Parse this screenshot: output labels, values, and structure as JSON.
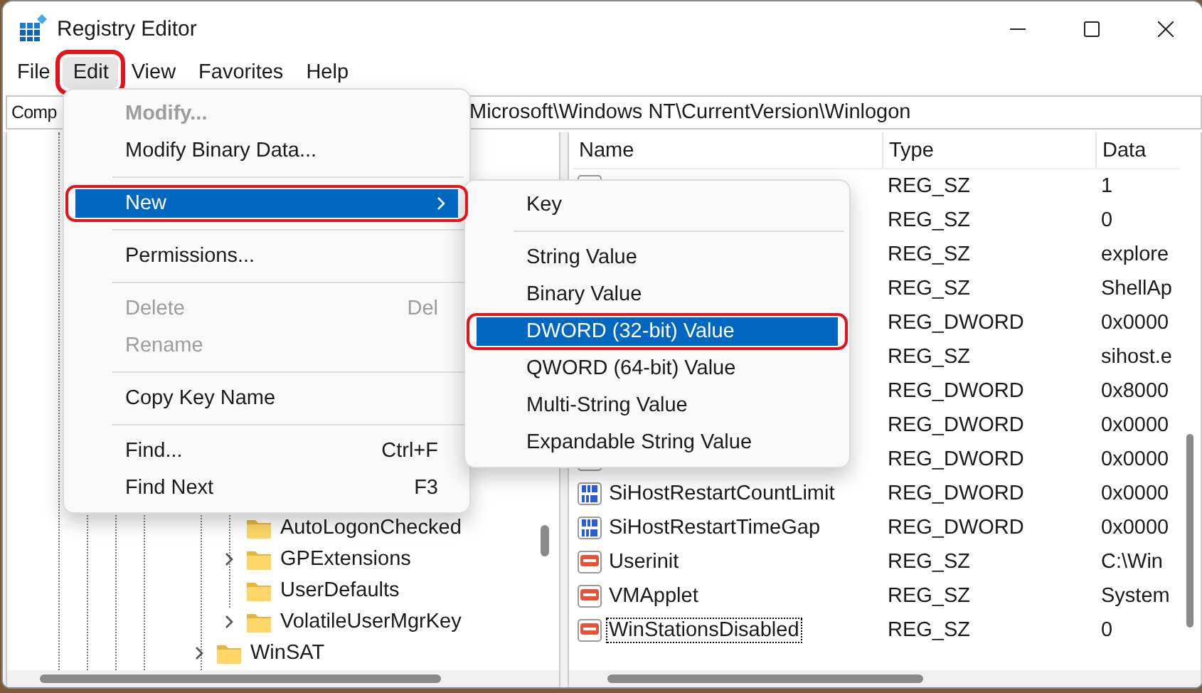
{
  "window": {
    "title": "Registry Editor"
  },
  "menu_bar": [
    {
      "label": "File",
      "open": false,
      "highlighted": false
    },
    {
      "label": "Edit",
      "open": true,
      "highlighted": true
    },
    {
      "label": "View",
      "open": false,
      "highlighted": false
    },
    {
      "label": "Favorites",
      "open": false,
      "highlighted": false
    },
    {
      "label": "Help",
      "open": false,
      "highlighted": false
    }
  ],
  "address_bar": {
    "text_start": "Comp",
    "text_end": "Microsoft\\Windows NT\\CurrentVersion\\Winlogon"
  },
  "tree": {
    "items": [
      {
        "children": [
          {
            "label": "AutoLogonChecked",
            "expandable": false
          },
          {
            "label": "GPExtensions",
            "expandable": true
          },
          {
            "label": "UserDefaults",
            "expandable": false
          },
          {
            "label": "VolatileUserMgrKey",
            "expandable": true
          }
        ]
      },
      {
        "label": "WinSAT",
        "expandable": true
      }
    ]
  },
  "values": {
    "columns": [
      "Name",
      "Type",
      "Data"
    ],
    "rows": [
      {
        "kind": "string",
        "type": "REG_SZ",
        "data": "1",
        "focused": false
      },
      {
        "type": "REG_SZ",
        "data": "0",
        "focused": false
      },
      {
        "type": "REG_SZ",
        "data": "explore",
        "focused": false
      },
      {
        "type": "REG_SZ",
        "data": "ShellAp",
        "focused": false
      },
      {
        "type": "REG_DWORD",
        "data": "0x0000",
        "focused": false
      },
      {
        "type": "REG_SZ",
        "data": "sihost.e",
        "focused": false
      },
      {
        "type": "REG_DWORD",
        "data": "0x8000",
        "focused": false
      },
      {
        "type": "REG_DWORD",
        "data": "0x0000",
        "focused": false
      },
      {
        "kind": "dword",
        "type": "REG_DWORD",
        "data": "0x0000",
        "focused": false
      },
      {
        "kind": "dword",
        "name": "SiHostRestartCountLimit",
        "type": "REG_DWORD",
        "data": "0x0000",
        "focused": false
      },
      {
        "kind": "dword",
        "name": "SiHostRestartTimeGap",
        "type": "REG_DWORD",
        "data": "0x0000",
        "focused": false
      },
      {
        "kind": "string",
        "name": "Userinit",
        "type": "REG_SZ",
        "data": "C:\\Win",
        "focused": false
      },
      {
        "kind": "string",
        "name": "VMApplet",
        "type": "REG_SZ",
        "data": "System",
        "focused": false
      },
      {
        "kind": "string",
        "name": "WinStationsDisabled",
        "type": "REG_SZ",
        "data": "0",
        "focused": true
      }
    ]
  },
  "edit_menu": {
    "items": [
      {
        "kind": "item",
        "label": "Modify...",
        "default": true,
        "disabled": true,
        "selected": false,
        "highlighted": false,
        "submenu": false
      },
      {
        "kind": "item",
        "label": "Modify Binary Data...",
        "default": false,
        "disabled": false,
        "selected": false,
        "highlighted": false,
        "submenu": false
      },
      {
        "kind": "separator"
      },
      {
        "kind": "item",
        "label": "New",
        "default": false,
        "disabled": false,
        "selected": true,
        "highlighted": true,
        "submenu": true
      },
      {
        "kind": "separator"
      },
      {
        "kind": "item",
        "label": "Permissions...",
        "default": false,
        "disabled": false,
        "selected": false,
        "highlighted": false,
        "submenu": false
      },
      {
        "kind": "separator"
      },
      {
        "kind": "item",
        "label": "Delete",
        "shortcut": "Del",
        "default": false,
        "disabled": true,
        "selected": false,
        "highlighted": false,
        "submenu": false
      },
      {
        "kind": "item",
        "label": "Rename",
        "default": false,
        "disabled": true,
        "selected": false,
        "highlighted": false,
        "submenu": false
      },
      {
        "kind": "separator"
      },
      {
        "kind": "item",
        "label": "Copy Key Name",
        "default": false,
        "disabled": false,
        "selected": false,
        "highlighted": false,
        "submenu": false
      },
      {
        "kind": "separator"
      },
      {
        "kind": "item",
        "label": "Find...",
        "shortcut": "Ctrl+F",
        "default": false,
        "disabled": false,
        "selected": false,
        "highlighted": false,
        "submenu": false
      },
      {
        "kind": "item",
        "label": "Find Next",
        "shortcut": "F3",
        "default": false,
        "disabled": false,
        "selected": false,
        "highlighted": false,
        "submenu": false
      }
    ]
  },
  "new_submenu": {
    "items": [
      {
        "kind": "item",
        "label": "Key",
        "default": false,
        "disabled": false,
        "selected": false,
        "highlighted": false,
        "submenu": false
      },
      {
        "kind": "separator"
      },
      {
        "kind": "item",
        "label": "String Value",
        "default": false,
        "disabled": false,
        "selected": false,
        "highlighted": false,
        "submenu": false
      },
      {
        "kind": "item",
        "label": "Binary Value",
        "default": false,
        "disabled": false,
        "selected": false,
        "highlighted": false,
        "submenu": false
      },
      {
        "kind": "item",
        "label": "DWORD (32-bit) Value",
        "default": false,
        "disabled": false,
        "selected": true,
        "highlighted": true,
        "submenu": false
      },
      {
        "kind": "item",
        "label": "QWORD (64-bit) Value",
        "default": false,
        "disabled": false,
        "selected": false,
        "highlighted": false,
        "submenu": false
      },
      {
        "kind": "item",
        "label": "Multi-String Value",
        "default": false,
        "disabled": false,
        "selected": false,
        "highlighted": false,
        "submenu": false
      },
      {
        "kind": "item",
        "label": "Expandable String Value",
        "default": false,
        "disabled": false,
        "selected": false,
        "highlighted": false,
        "submenu": false
      }
    ]
  }
}
